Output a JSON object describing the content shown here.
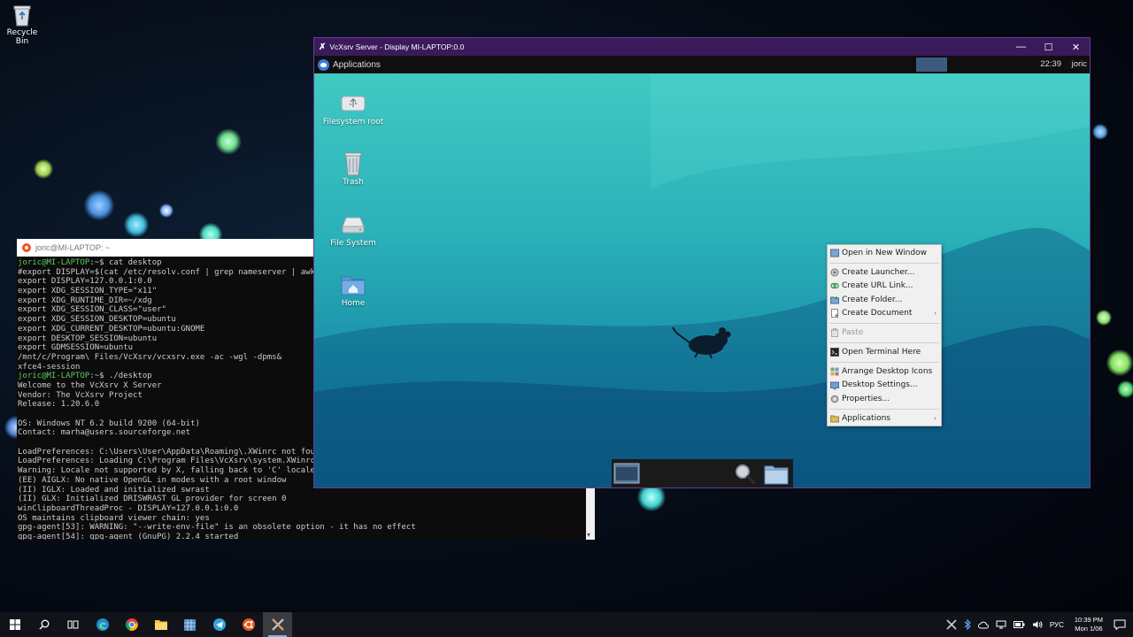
{
  "desktop": {
    "recycle_bin_label": "Recycle Bin"
  },
  "terminal": {
    "title": "joric@MI-LAPTOP: ~",
    "lines": [
      {
        "prompt": "joric@MI-LAPTOP",
        "rest": ":~$ cat desktop"
      },
      {
        "prompt": "",
        "rest": "#export DISPLAY=$(cat /etc/resolv.conf | grep nameserver | awk"
      },
      {
        "prompt": "",
        "rest": "export DISPLAY=127.0.0.1:0.0"
      },
      {
        "prompt": "",
        "rest": "export XDG_SESSION_TYPE=\"x11\""
      },
      {
        "prompt": "",
        "rest": "export XDG_RUNTIME_DIR=~/xdg"
      },
      {
        "prompt": "",
        "rest": "export XDG_SESSION_CLASS=\"user\""
      },
      {
        "prompt": "",
        "rest": "export XDG_SESSION_DESKTOP=ubuntu"
      },
      {
        "prompt": "",
        "rest": "export XDG_CURRENT_DESKTOP=ubuntu:GNOME"
      },
      {
        "prompt": "",
        "rest": "export DESKTOP_SESSION=ubuntu"
      },
      {
        "prompt": "",
        "rest": "export GDMSESSION=ubuntu"
      },
      {
        "prompt": "",
        "rest": "/mnt/c/Program\\ Files/VcXsrv/vcxsrv.exe -ac -wgl -dpms&"
      },
      {
        "prompt": "",
        "rest": "xfce4-session"
      },
      {
        "prompt": "joric@MI-LAPTOP",
        "rest": ":~$ ./desktop"
      },
      {
        "prompt": "",
        "rest": "Welcome to the VcXsrv X Server"
      },
      {
        "prompt": "",
        "rest": "Vendor: The VcXsrv Project"
      },
      {
        "prompt": "",
        "rest": "Release: 1.20.6.0"
      },
      {
        "prompt": "",
        "rest": ""
      },
      {
        "prompt": "",
        "rest": "OS: Windows NT 6.2 build 9200 (64-bit)"
      },
      {
        "prompt": "",
        "rest": "Contact: marha@users.sourceforge.net"
      },
      {
        "prompt": "",
        "rest": ""
      },
      {
        "prompt": "",
        "rest": "LoadPreferences: C:\\Users\\User\\AppData\\Roaming\\.XWinrc not four"
      },
      {
        "prompt": "",
        "rest": "LoadPreferences: Loading C:\\Program Files\\VcXsrv\\system.XWinrc"
      },
      {
        "prompt": "",
        "rest": "Warning: Locale not supported by X, falling back to 'C' locale."
      },
      {
        "prompt": "",
        "rest": "(EE) AIGLX: No native OpenGL in modes with a root window"
      },
      {
        "prompt": "",
        "rest": "(II) IGLX: Loaded and initialized swrast"
      },
      {
        "prompt": "",
        "rest": "(II) GLX: Initialized DRISWRAST GL provider for screen 0"
      },
      {
        "prompt": "",
        "rest": "winClipboardThreadProc - DISPLAY=127.0.0.1:0.0"
      },
      {
        "prompt": "",
        "rest": "OS maintains clipboard viewer chain: yes"
      },
      {
        "prompt": "",
        "rest": "gpg-agent[53]: WARNING: \"--write-env-file\" is an obsolete option - it has no effect"
      },
      {
        "prompt": "",
        "rest": "gpg-agent[54]: gpg-agent (GnuPG) 2.2.4 started"
      }
    ]
  },
  "vcxsrv": {
    "title": "VcXsrv Server - Display MI-LAPTOP:0.0",
    "minimize": "—",
    "maximize": "☐",
    "close": "✕"
  },
  "xfce_panel": {
    "applications": "Applications",
    "clock": "22:39",
    "user": "joric"
  },
  "xfce_desktop_icons": [
    {
      "name": "filesystem-root",
      "label": "Filesystem root"
    },
    {
      "name": "trash",
      "label": "Trash"
    },
    {
      "name": "file-system",
      "label": "File System"
    },
    {
      "name": "home",
      "label": "Home"
    }
  ],
  "context_menu": {
    "open_new_window": "Open in New Window",
    "create_launcher": "Create Launcher...",
    "create_url_link": "Create URL Link...",
    "create_folder": "Create Folder...",
    "create_document": "Create Document",
    "paste": "Paste",
    "open_terminal": "Open Terminal Here",
    "arrange_icons": "Arrange Desktop Icons",
    "desktop_settings": "Desktop Settings...",
    "properties": "Properties...",
    "applications": "Applications",
    "submenu_arrow": "›"
  },
  "taskbar": {
    "lang": "РУС",
    "time": "10:39 PM",
    "date": "Mon 1/06"
  }
}
